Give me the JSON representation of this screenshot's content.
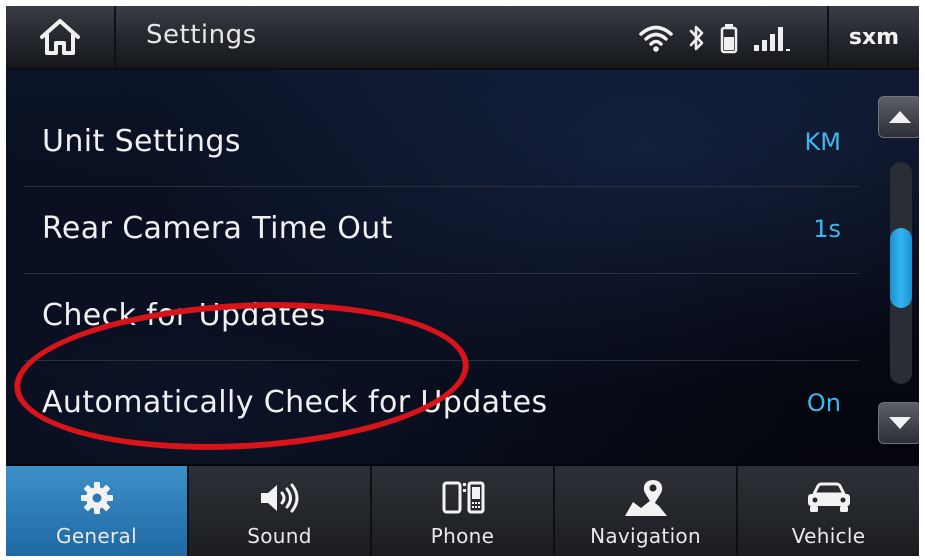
{
  "header": {
    "title": "Settings",
    "right_button_label": "sxm",
    "icons": [
      "home-icon",
      "wifi-icon",
      "bluetooth-icon",
      "battery-icon",
      "signal-icon"
    ]
  },
  "settings": {
    "rows": [
      {
        "label": "Unit Settings",
        "value": "KM"
      },
      {
        "label": "Rear Camera Time Out",
        "value": "1s"
      },
      {
        "label": "Check for Updates",
        "value": ""
      },
      {
        "label": "Automatically Check for Updates",
        "value": "On"
      }
    ]
  },
  "scrollbar": {
    "position": 0.45
  },
  "nav": {
    "tabs": [
      {
        "label": "General",
        "icon": "gear-icon",
        "active": true
      },
      {
        "label": "Sound",
        "icon": "speaker-icon",
        "active": false
      },
      {
        "label": "Phone",
        "icon": "phone-icon",
        "active": false
      },
      {
        "label": "Navigation",
        "icon": "map-pin-icon",
        "active": false
      },
      {
        "label": "Vehicle",
        "icon": "car-icon",
        "active": false
      }
    ]
  },
  "colors": {
    "accent": "#3fb6ee",
    "active_tab": "#2f7fbf",
    "highlight_ring": "#d8141b"
  }
}
